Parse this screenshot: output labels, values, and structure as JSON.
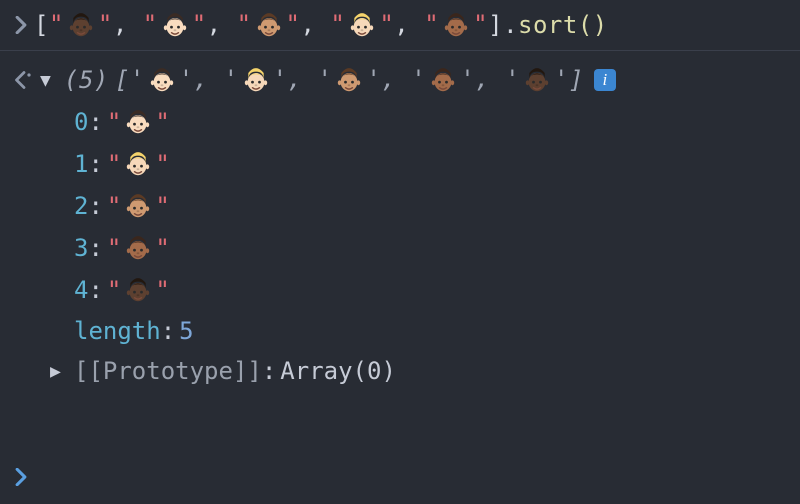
{
  "colors": {
    "bg": "#282c34",
    "string": "#e06c75",
    "prop": "#dcdcaa",
    "key": "#5fb3d3",
    "num": "#7ea7d8",
    "badge": "#3b86d1"
  },
  "emoji_palette": {
    "tone1": {
      "skin": "#f9dcbf",
      "hair": "#3a2b24"
    },
    "tone2": {
      "skin": "#f6d8b9",
      "hair": "#f4d36b"
    },
    "tone3": {
      "skin": "#cf9a71",
      "hair": "#5b3a24"
    },
    "tone4": {
      "skin": "#a36b4a",
      "hair": "#3a261c"
    },
    "tone5": {
      "skin": "#5d4030",
      "hair": "#22170f"
    }
  },
  "input": {
    "open": "[",
    "quoted_items": [
      "tone5",
      "tone1",
      "tone3",
      "tone2",
      "tone4"
    ],
    "close": "]",
    "dot": ".",
    "method": "sort",
    "call": "()"
  },
  "output": {
    "count_label": "(5)",
    "open": "[",
    "quote": "'",
    "items": [
      "tone1",
      "tone2",
      "tone3",
      "tone4",
      "tone5"
    ],
    "close": "]",
    "info_label": "i"
  },
  "expanded": {
    "entries": [
      {
        "key": "0",
        "tone": "tone1"
      },
      {
        "key": "1",
        "tone": "tone2"
      },
      {
        "key": "2",
        "tone": "tone3"
      },
      {
        "key": "3",
        "tone": "tone4"
      },
      {
        "key": "4",
        "tone": "tone5"
      }
    ],
    "length_key": "length",
    "length_val": "5",
    "proto_key": "[[Prototype]]",
    "proto_val": "Array(0)"
  },
  "glyphs": {
    "quote_double": "\"",
    "comma_space": ", ",
    "colon_space": ": "
  }
}
